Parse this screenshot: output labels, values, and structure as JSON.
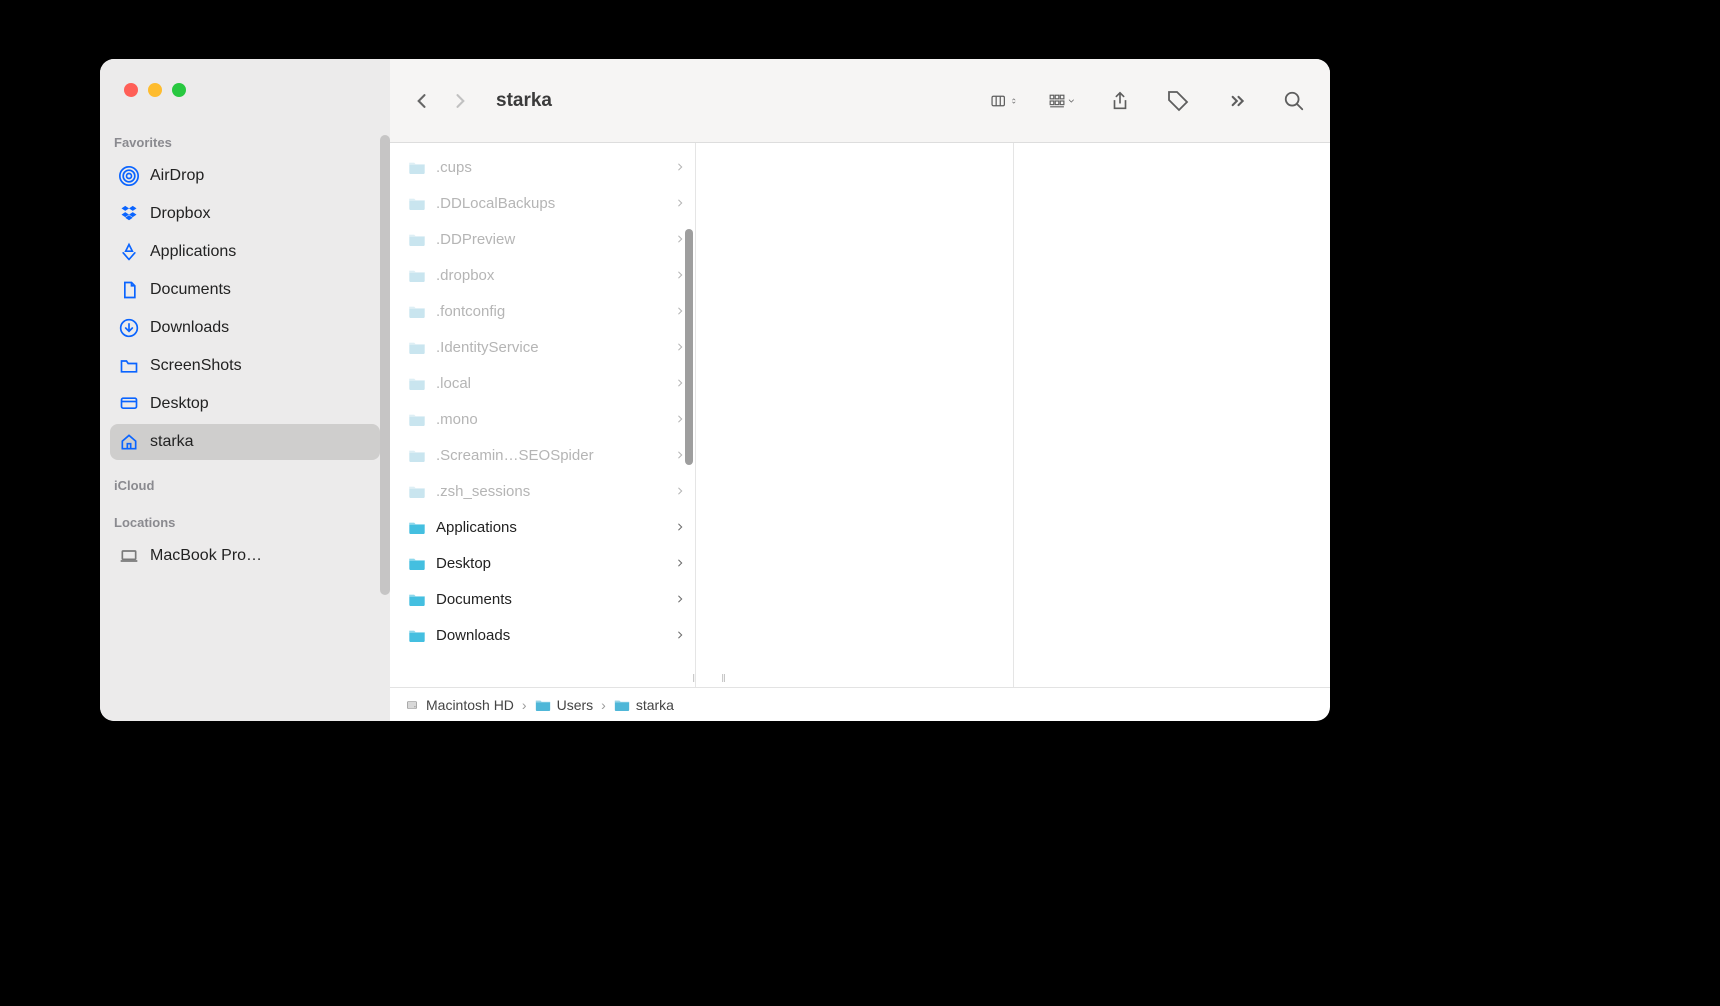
{
  "window_title": "starka",
  "sidebar": {
    "sections": [
      {
        "label": "Favorites",
        "items": [
          {
            "icon": "airdrop",
            "label": "AirDrop"
          },
          {
            "icon": "dropbox",
            "label": "Dropbox"
          },
          {
            "icon": "applications",
            "label": "Applications"
          },
          {
            "icon": "document",
            "label": "Documents"
          },
          {
            "icon": "download",
            "label": "Downloads"
          },
          {
            "icon": "folder",
            "label": "ScreenShots"
          },
          {
            "icon": "desktop",
            "label": "Desktop"
          },
          {
            "icon": "home",
            "label": "starka",
            "selected": true
          }
        ]
      },
      {
        "label": "iCloud",
        "items": []
      },
      {
        "label": "Locations",
        "items": [
          {
            "icon": "laptop",
            "label": "MacBook Pro…",
            "gray": true
          }
        ]
      }
    ]
  },
  "column1": {
    "items": [
      {
        "label": ".cups",
        "dim": true
      },
      {
        "label": ".DDLocalBackups",
        "dim": true
      },
      {
        "label": ".DDPreview",
        "dim": true
      },
      {
        "label": ".dropbox",
        "dim": true
      },
      {
        "label": ".fontconfig",
        "dim": true
      },
      {
        "label": ".IdentityService",
        "dim": true
      },
      {
        "label": ".local",
        "dim": true
      },
      {
        "label": ".mono",
        "dim": true
      },
      {
        "label": ".Screamin…SEOSpider",
        "dim": true
      },
      {
        "label": ".zsh_sessions",
        "dim": true
      },
      {
        "label": "Applications",
        "dim": false
      },
      {
        "label": "Desktop",
        "dim": false
      },
      {
        "label": "Documents",
        "dim": false
      },
      {
        "label": "Downloads",
        "dim": false
      }
    ]
  },
  "pathbar": {
    "segments": [
      {
        "icon": "hdd",
        "label": "Macintosh HD"
      },
      {
        "icon": "folder",
        "label": "Users"
      },
      {
        "icon": "folder",
        "label": "starka"
      }
    ]
  }
}
